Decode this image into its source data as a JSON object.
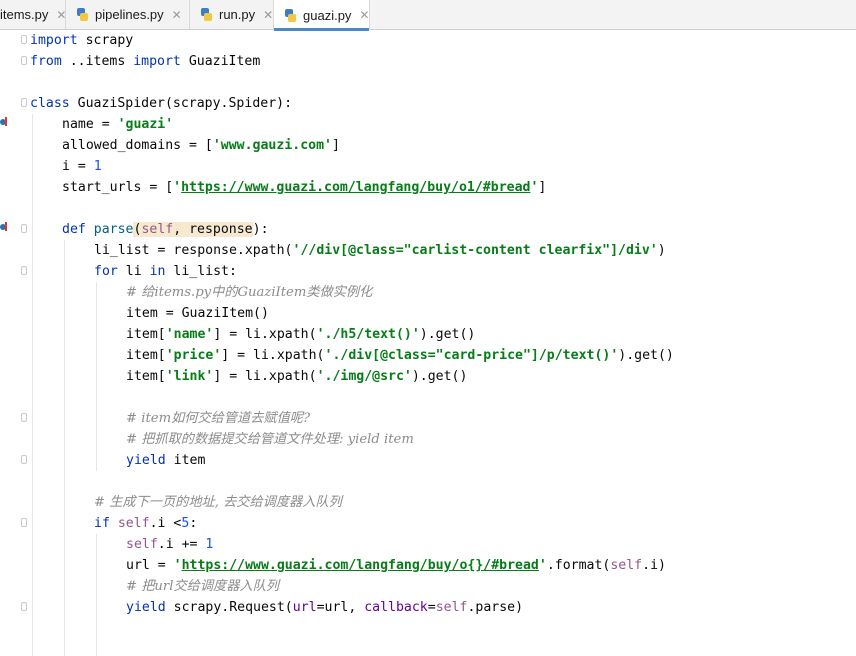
{
  "tabs": [
    {
      "label": "items.py",
      "active": false
    },
    {
      "label": "pipelines.py",
      "active": false
    },
    {
      "label": "run.py",
      "active": false
    },
    {
      "label": "guazi.py",
      "active": true
    }
  ],
  "close_glyph": "✕",
  "code": {
    "l1": [
      "import",
      " scrapy"
    ],
    "l2": [
      "from",
      " ..items ",
      "import",
      " GuaziItem"
    ],
    "l4": [
      "class",
      " GuaziSpider(scrapy.Spider):"
    ],
    "l5": [
      "name = ",
      "'guazi'"
    ],
    "l6": [
      "allowed_domains = [",
      "'www.gauzi.com'",
      "]"
    ],
    "l7": [
      "i = ",
      "1"
    ],
    "l8": [
      "start_urls = [",
      "'",
      "https://www.guazi.com/langfang/buy/o1/#bread",
      "'",
      "]"
    ],
    "l10": [
      "def",
      " ",
      "parse",
      "(",
      "self",
      ", ",
      "response",
      "):"
    ],
    "l11": [
      "li_list = response.xpath(",
      "'//div[@class=\"carlist-content clearfix\"]/div'",
      ")"
    ],
    "l12": [
      "for",
      " li ",
      "in",
      " li_list:"
    ],
    "l13": [
      "# 给items.py中的GuaziItem类做实例化"
    ],
    "l14": [
      "item = GuaziItem()"
    ],
    "l15": [
      "item[",
      "'name'",
      "] = li.xpath(",
      "'./h5/text()'",
      ").get()"
    ],
    "l16": [
      "item[",
      "'price'",
      "] = li.xpath(",
      "'./div[@class=\"card-price\"]/p/text()'",
      ").get()"
    ],
    "l17": [
      "item[",
      "'link'",
      "] = li.xpath(",
      "'./img/@src'",
      ").get()"
    ],
    "l19": [
      "# item如何交给管道去赋值呢?"
    ],
    "l20": [
      "# 把抓取的数据提交给管道文件处理: yield item"
    ],
    "l21": [
      "yield",
      " item"
    ],
    "l23": [
      "# 生成下一页的地址, 去交给调度器入队列"
    ],
    "l24": [
      "if",
      " ",
      "self",
      ".i <",
      "5",
      ":"
    ],
    "l25": [
      "self",
      ".i += ",
      "1"
    ],
    "l26": [
      "url = ",
      "'",
      "https://www.guazi.com/langfang/buy/o{}/#bread",
      "'",
      ".format(",
      "self",
      ".i)"
    ],
    "l27": [
      "# 把url交给调度器入队列"
    ],
    "l28": [
      "yield",
      " scrapy.Request(",
      "url",
      "=url, ",
      "callback",
      "=",
      "self",
      ".parse)"
    ]
  }
}
